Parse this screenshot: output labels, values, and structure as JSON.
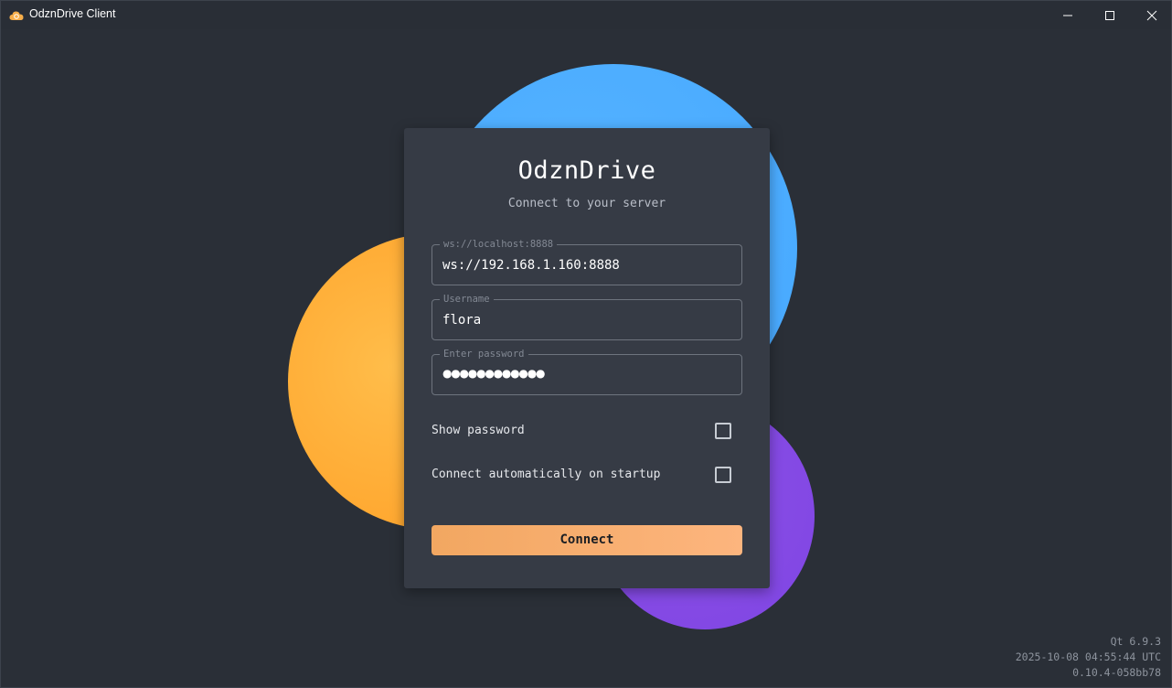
{
  "window": {
    "title": "OdznDrive Client",
    "icon": "cloud-icon",
    "controls": [
      "minimize-icon",
      "maximize-icon",
      "close-icon"
    ]
  },
  "login": {
    "title": "OdznDrive",
    "subtitle": "Connect to your server",
    "server": {
      "label": "ws://localhost:8888",
      "value": "ws://192.168.1.160:8888"
    },
    "username": {
      "label": "Username",
      "value": "flora"
    },
    "password": {
      "label": "Enter password",
      "masked_value": "●●●●●●●●●●●●"
    },
    "show_password": {
      "label": "Show password",
      "checked": false
    },
    "auto_connect": {
      "label": "Connect automatically on startup",
      "checked": false
    },
    "connect_label": "Connect"
  },
  "footer": {
    "qt_version": "Qt 6.9.3",
    "build_date": "2025-10-08 04:55:44 UTC",
    "build_version": "0.10.4-058bb78"
  },
  "colors": {
    "background": "#2a2f37",
    "card": "#363b45",
    "blob_blue": "#4aabff",
    "blob_orange": "#ffad3a",
    "blob_purple": "#8049e4",
    "accent_button": "#f6ad6e"
  }
}
